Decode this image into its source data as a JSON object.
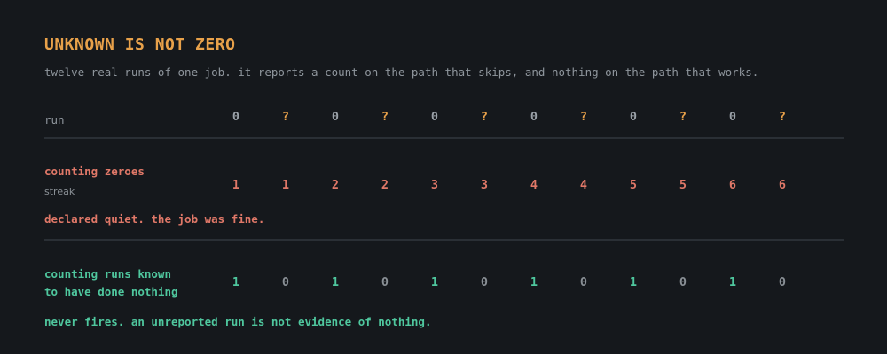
{
  "title": "UNKNOWN IS NOT ZERO",
  "subtitle": "twelve real runs of one job. it reports a count on the path that skips, and nothing on the path that works.",
  "rows": {
    "run": {
      "label": "run",
      "values": [
        "0",
        "?",
        "0",
        "?",
        "0",
        "?",
        "0",
        "?",
        "0",
        "?",
        "0",
        "?"
      ]
    },
    "counting_zeroes": {
      "label": "counting zeroes",
      "sublabel": "streak",
      "values": [
        "1",
        "1",
        "2",
        "2",
        "3",
        "3",
        "4",
        "4",
        "5",
        "5",
        "6",
        "6"
      ],
      "note": "declared quiet. the job was fine."
    },
    "counting_known": {
      "label_line1": "counting runs known",
      "label_line2": "to have done nothing",
      "values": [
        "1",
        "0",
        "1",
        "0",
        "1",
        "0",
        "1",
        "0",
        "1",
        "0",
        "1",
        "0"
      ],
      "note": "never fires. an unreported run is not evidence of nothing."
    }
  },
  "colors": {
    "background": "#15181c",
    "title": "#e8a14a",
    "unknown": "#e8a14a",
    "zero_path": "#e07868",
    "known_path": "#4fc79e",
    "muted": "#9aa1a8"
  }
}
